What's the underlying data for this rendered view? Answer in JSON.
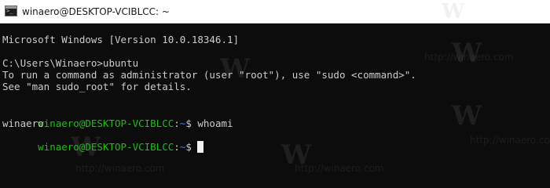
{
  "window": {
    "title": "winaero@DESKTOP-VCIBLCC: ~",
    "icon": "terminal-icon"
  },
  "console": {
    "version_line": "Microsoft Windows [Version 10.0.18346.1]",
    "prompt_line": "C:\\Users\\Winaero>ubuntu",
    "info_line_1": "To run a command as administrator (user \"root\"), use \"sudo <command>\".",
    "info_line_2": "See \"man sudo_root\" for details.",
    "prompt1_user": "winaero@DESKTOP-VCIBLCC",
    "prompt1_sep": ":",
    "prompt1_path": "~",
    "prompt1_tail": "$ whoami",
    "output_line": "winaero",
    "prompt2_user": "winaero@DESKTOP-VCIBLCC",
    "prompt2_sep": ":",
    "prompt2_path": "~",
    "prompt2_tail": "$ "
  },
  "watermark": {
    "letter": "W",
    "text": "http://winaero.com"
  },
  "colors": {
    "background": "#0c0c0c",
    "text": "#cccccc",
    "prompt_user": "#16c60c",
    "prompt_path": "#3b78ff"
  }
}
